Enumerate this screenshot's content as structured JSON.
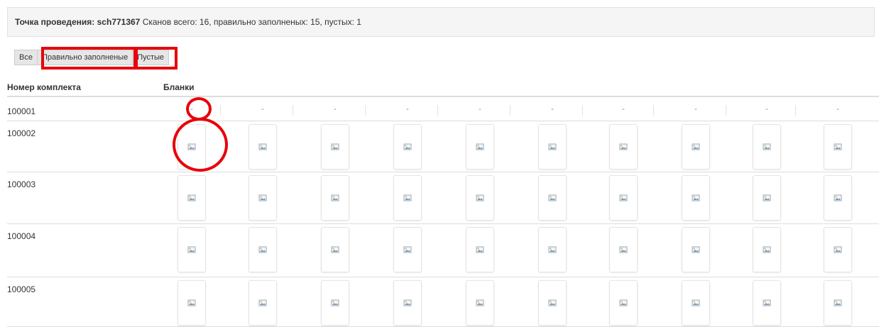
{
  "header": {
    "title": "Точка проведения: sch771367",
    "stats": "Сканов всего: 16, правильно заполненых: 15, пустых: 1"
  },
  "filters": [
    {
      "label": "Все",
      "name": "filter-all"
    },
    {
      "label": "Правильно заполненые",
      "name": "filter-correct"
    },
    {
      "label": "Пустые",
      "name": "filter-empty"
    }
  ],
  "columns": {
    "set_number": "Номер комплекта",
    "blanks": "Бланки"
  },
  "rows": [
    {
      "id": "100001",
      "kind": "dash",
      "blanks": [
        "-",
        "-",
        "-",
        "-",
        "-",
        "-",
        "-",
        "-",
        "-",
        "-"
      ]
    },
    {
      "id": "100002",
      "kind": "image",
      "blank_count": 10,
      "blank_icon": "image-icon"
    },
    {
      "id": "100003",
      "kind": "image",
      "blank_count": 10,
      "blank_icon": "image-icon"
    },
    {
      "id": "100004",
      "kind": "image",
      "blank_count": 10,
      "blank_icon": "image-icon"
    },
    {
      "id": "100005",
      "kind": "image",
      "blank_count": 10,
      "blank_icon": "image-icon"
    }
  ],
  "colors": {
    "annotation": "#e8000b",
    "header_bg": "#f5f5f5"
  }
}
